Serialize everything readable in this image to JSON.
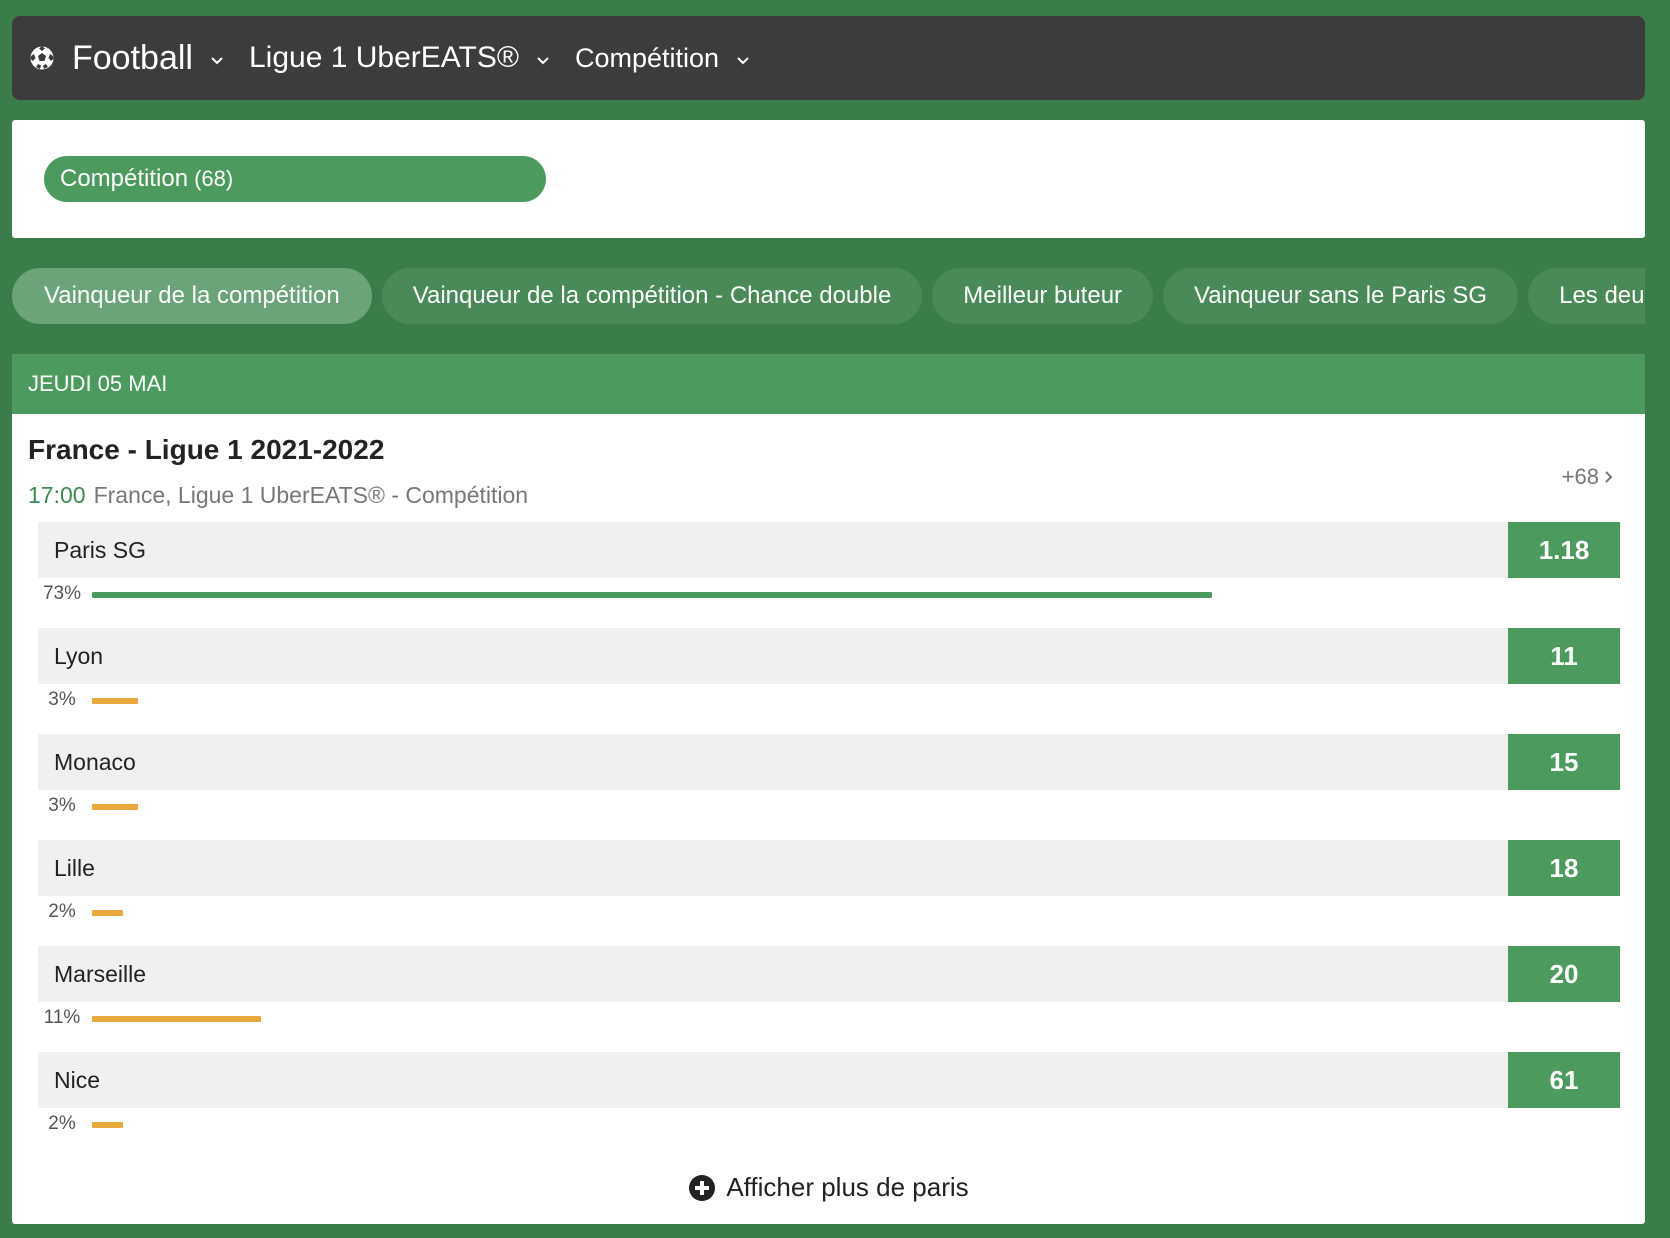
{
  "topbar": {
    "sport": "Football",
    "league": "Ligue 1 UberEATS®",
    "view": "Compétition"
  },
  "filter": {
    "label": "Compétition",
    "count": "(68)"
  },
  "tabs": [
    "Vainqueur de la compétition",
    "Vainqueur de la compétition - Chance double",
    "Meilleur buteur",
    "Vainqueur sans le Paris SG",
    "Les deux"
  ],
  "day_header": "JEUDI 05 MAI",
  "event": {
    "title": "France - Ligue 1 2021-2022",
    "time": "17:00",
    "subtitle": "France, Ligue 1 UberEATS® - Compétition",
    "more": "+68"
  },
  "selections": [
    {
      "team": "Paris SG",
      "odd": "1.18",
      "pct_label": "73%",
      "pct": 73
    },
    {
      "team": "Lyon",
      "odd": "11",
      "pct_label": "3%",
      "pct": 3
    },
    {
      "team": "Monaco",
      "odd": "15",
      "pct_label": "3%",
      "pct": 3
    },
    {
      "team": "Lille",
      "odd": "18",
      "pct_label": "2%",
      "pct": 2
    },
    {
      "team": "Marseille",
      "odd": "20",
      "pct_label": "11%",
      "pct": 11
    },
    {
      "team": "Nice",
      "odd": "61",
      "pct_label": "2%",
      "pct": 2
    }
  ],
  "show_more": "Afficher plus de paris",
  "colors": {
    "brand_green": "#4d9a5e",
    "bar_leader": "#4d9a5e",
    "bar_other": "#e8a93a"
  }
}
